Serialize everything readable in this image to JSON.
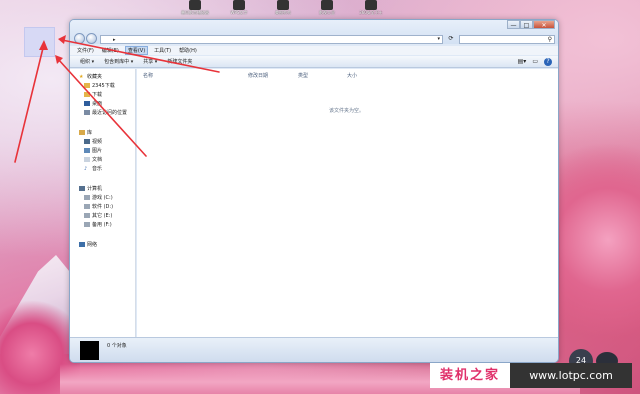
{
  "desktop": {
    "top_icons": [
      "暴风影音播放器",
      "WPS文字",
      "美图秀秀",
      "影视大全",
      "360安全卫士"
    ],
    "clock_value": "24"
  },
  "window": {
    "address": {
      "value": "",
      "arrow": "▸"
    },
    "search": {
      "placeholder": ""
    },
    "controls": {
      "minimize": "—",
      "maximize": "□",
      "close": "✕"
    },
    "menu": [
      {
        "label": "文件(F)"
      },
      {
        "label": "编辑(E)"
      },
      {
        "label": "查看(V)",
        "active": true
      },
      {
        "label": "工具(T)"
      },
      {
        "label": "帮助(H)"
      }
    ],
    "toolbar": [
      {
        "label": "组织 ▾"
      },
      {
        "label": "包含到库中 ▾"
      },
      {
        "label": "共享 ▾"
      },
      {
        "label": "新建文件夹"
      }
    ],
    "sidebar": {
      "favorites": {
        "label": "收藏夹",
        "items": [
          "2345下载",
          "下载",
          "桌面",
          "最近访问的位置"
        ]
      },
      "libraries": {
        "label": "库",
        "items": [
          "视频",
          "图片",
          "文档",
          "音乐"
        ]
      },
      "computer": {
        "label": "计算机",
        "items": [
          "游戏 (C:)",
          "软件 (D:)",
          "其它 (E:)",
          "备用 (F:)"
        ]
      },
      "network": {
        "label": "网络"
      }
    },
    "columns": [
      "名称",
      "修改日期",
      "类型",
      "大小"
    ],
    "empty_message": "该文件夹为空。",
    "status": "0 个对象"
  },
  "watermark": {
    "cn": "装机之家",
    "url": "www.lotpc.com"
  }
}
